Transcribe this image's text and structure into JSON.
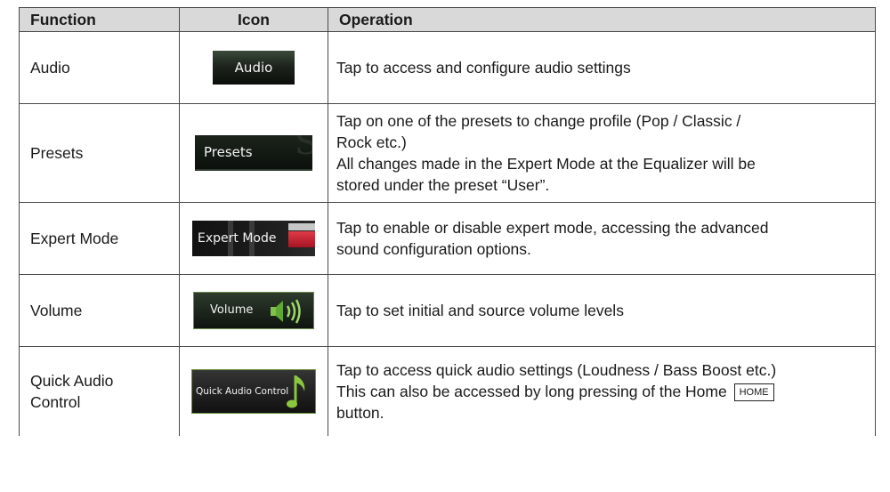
{
  "headers": {
    "function": "Function",
    "icon": "Icon",
    "operation": "Operation"
  },
  "rows": [
    {
      "function": "Audio",
      "icon_label": "Audio",
      "operation": [
        "Tap to access and configure audio settings"
      ]
    },
    {
      "function": "Presets",
      "icon_label": "Presets",
      "operation": [
        "Tap on one of the presets to change profile (Pop / Classic /",
        "Rock etc.)",
        "All changes made in the Expert Mode at the Equalizer will be",
        "stored under the preset “User”."
      ]
    },
    {
      "function": "Expert Mode",
      "icon_label": "Expert Mode",
      "operation": [
        "Tap to enable or disable expert mode, accessing the advanced",
        "sound configuration options."
      ]
    },
    {
      "function": "Volume",
      "icon_label": "Volume",
      "operation": [
        "Tap to set initial and source volume levels"
      ]
    },
    {
      "function_lines": [
        "Quick Audio",
        "Control"
      ],
      "icon_label": "Quick Audio Control",
      "operation": [
        "Tap to access quick audio settings (Loudness / Bass Boost  etc.)",
        "This can also be accessed by long pressing of the Home"
      ],
      "home_key": "HOME",
      "operation_tail": "button."
    }
  ],
  "icons": {
    "volume": "speaker-icon",
    "quick_audio": "music-note-icon"
  },
  "colors": {
    "header_bg": "#d9d9d9",
    "border": "#4a4a4a",
    "accent_green": "#6b8f3a",
    "accent_red": "#c8202e"
  }
}
